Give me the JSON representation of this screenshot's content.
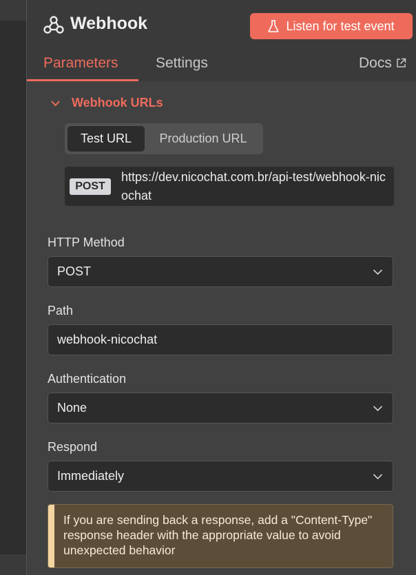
{
  "header": {
    "title": "Webhook",
    "node_icon": "webhook-icon",
    "listen_button": "Listen for test event",
    "listen_icon": "flask-icon"
  },
  "tabs": [
    {
      "label": "Parameters",
      "active": true
    },
    {
      "label": "Settings",
      "active": false
    },
    {
      "label": "Docs",
      "active": false,
      "icon": "external-link-icon"
    }
  ],
  "webhook_urls": {
    "section_title": "Webhook URLs",
    "toggle": [
      {
        "label": "Test URL",
        "selected": true
      },
      {
        "label": "Production URL",
        "selected": false
      }
    ],
    "method": "POST",
    "url": "https://dev.nicochat.com.br/api-test/webhook-nicochat"
  },
  "fields": {
    "http_method": {
      "label": "HTTP Method",
      "value": "POST"
    },
    "path": {
      "label": "Path",
      "value": "webhook-nicochat"
    },
    "authentication": {
      "label": "Authentication",
      "value": "None"
    },
    "respond": {
      "label": "Respond",
      "value": "Immediately"
    }
  },
  "notice": "If you are sending back a response, add a \"Content-Type\" response header with the appropriate value to avoid unexpected behavior",
  "colors": {
    "accent": "#ee6b5c",
    "panel": "#414141",
    "notice_bg": "#5c4d38"
  }
}
